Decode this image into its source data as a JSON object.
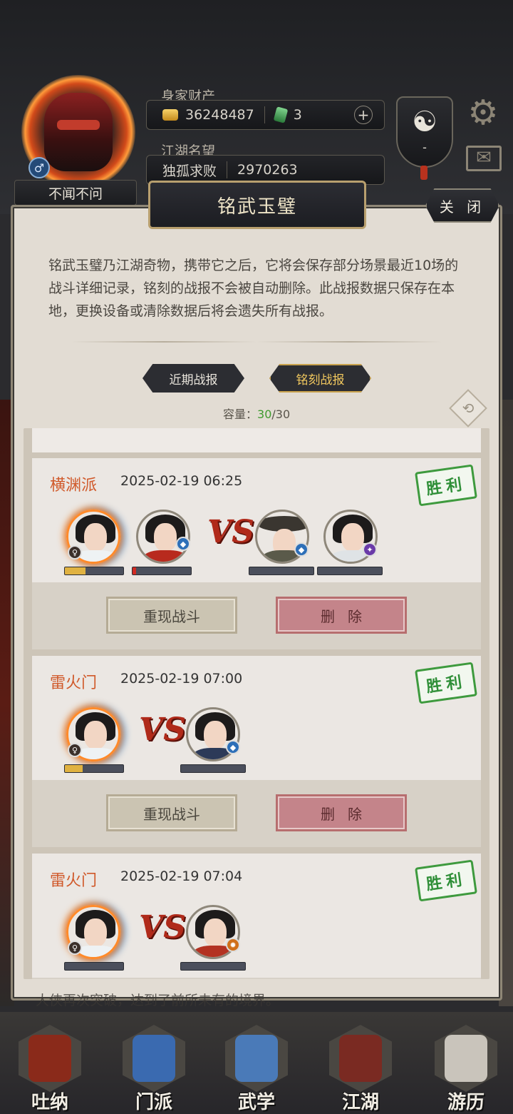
{
  "player": {
    "nickname": "不闻不问",
    "gender_symbol": "♂",
    "wealth_label": "身家财产",
    "gold": "36248487",
    "jade": "3",
    "fame_label": "江湖名望",
    "fame_title": "独孤求败",
    "fame_value": "2970263",
    "add_symbol": "+",
    "taiji_symbol": "☯",
    "taiji_value": "-"
  },
  "top_icons": {
    "settings": "⚙",
    "mail": "✉"
  },
  "dialog": {
    "title": "铭武玉璧",
    "close_label": "关 闭",
    "intro": "铭武玉璧乃江湖奇物，携带它之后，它将会保存部分场景最近10场的战斗详细记录，铭刻的战报不会被自动删除。此战报数据只保存在本地，更换设备或清除数据后将会遗失所有战报。",
    "tabs": [
      {
        "label": "近期战报",
        "active": false
      },
      {
        "label": "铭刻战报",
        "active": true
      }
    ],
    "capacity_label": "容量：",
    "capacity_used": "30",
    "capacity_total": "/30",
    "refresh_symbol": "⟲"
  },
  "records": [
    {
      "sect": "横渊派",
      "time": "2025-02-19 06:25",
      "result": "胜利",
      "allies": [
        {
          "name": "hero",
          "hp": 0.35
        },
        {
          "name": "red-dress-ally",
          "hp": 0.05
        }
      ],
      "enemies": [
        {
          "name": "straw-hat-enemy",
          "hp": 0
        },
        {
          "name": "swordsman-enemy",
          "hp": 0
        }
      ],
      "vs": "VS",
      "replay_label": "重现战斗",
      "delete_label": "删除"
    },
    {
      "sect": "雷火门",
      "time": "2025-02-19 07:00",
      "result": "胜利",
      "allies": [
        {
          "name": "hero",
          "hp": 0.3
        }
      ],
      "enemies": [
        {
          "name": "blue-robe-enemy",
          "hp": 0
        }
      ],
      "vs": "VS",
      "replay_label": "重现战斗",
      "delete_label": "删除"
    },
    {
      "sect": "雷火门",
      "time": "2025-02-19 07:04",
      "result": "胜利",
      "allies": [
        {
          "name": "hero",
          "hp": 0
        }
      ],
      "enemies": [
        {
          "name": "red-robe-enemy",
          "hp": 0
        }
      ],
      "vs": "VS"
    }
  ],
  "behind_text": "大侠再次突破，达到了前所未有的境界。",
  "nav": [
    {
      "label": "吐纳",
      "color": "#8a2a1a"
    },
    {
      "label": "门派",
      "color": "#3a6ab0"
    },
    {
      "label": "武学",
      "color": "#4a7ab8"
    },
    {
      "label": "江湖",
      "color": "#7a2a22"
    },
    {
      "label": "游历",
      "color": "#c9c4bb"
    }
  ]
}
